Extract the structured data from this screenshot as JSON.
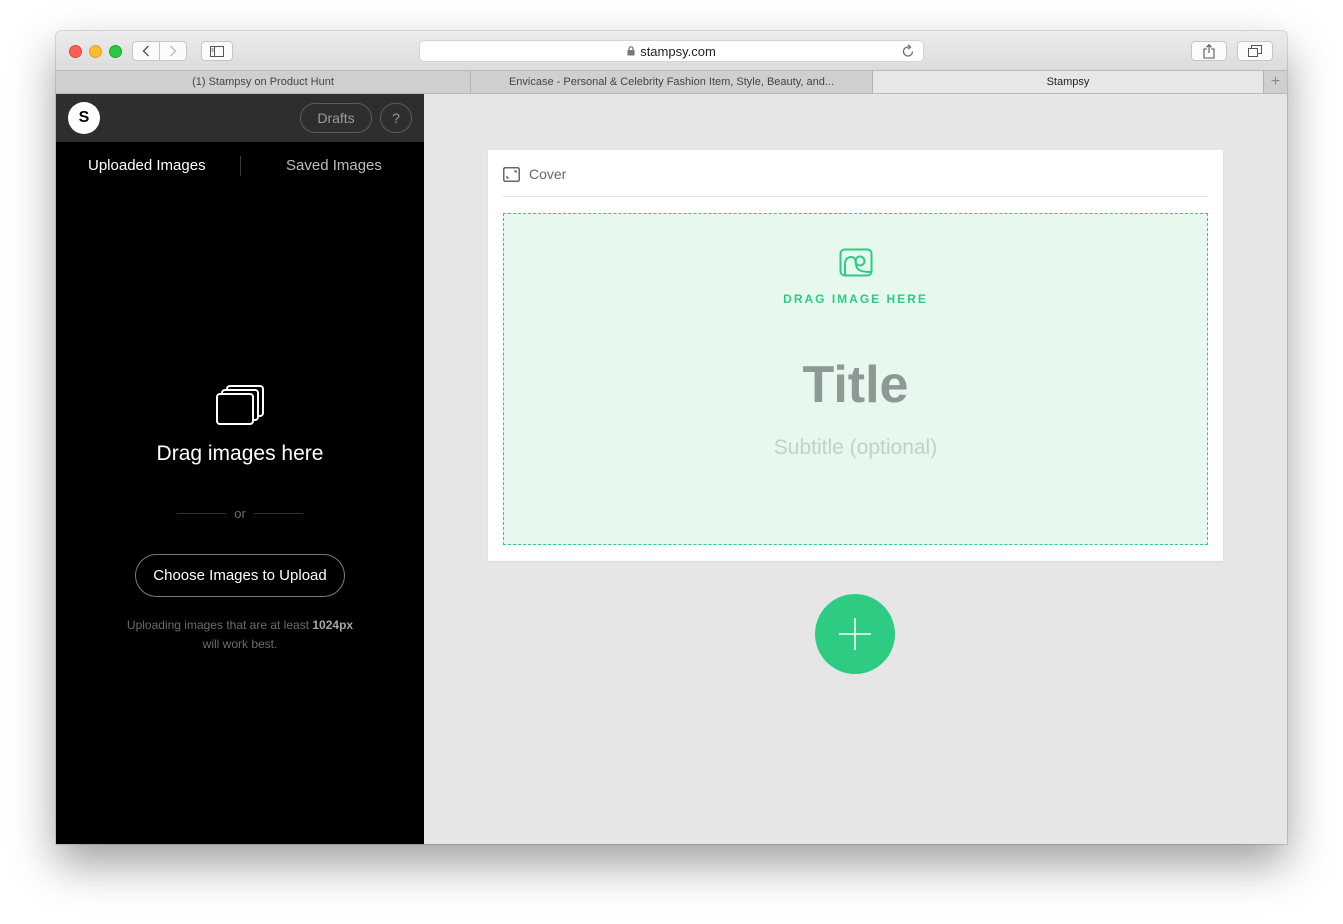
{
  "browser": {
    "url": "stampsy.com",
    "tabs": [
      {
        "label": "(1) Stampsy on Product Hunt"
      },
      {
        "label": "Envicase - Personal & Celebrity Fashion Item, Style, Beauty, and..."
      },
      {
        "label": "Stampsy"
      }
    ],
    "new_tab_label": "+"
  },
  "app": {
    "logo_letter": "S",
    "drafts_label": "Drafts",
    "help_label": "?",
    "tabs": {
      "uploaded": "Uploaded Images",
      "saved": "Saved Images"
    },
    "drop_title": "Drag images here",
    "or_label": "or",
    "choose_button": "Choose Images to Upload",
    "hint": {
      "prefix": "Uploading images that are at least ",
      "size": "1024px",
      "suffix": "will work best."
    }
  },
  "editor": {
    "card_label": "Cover",
    "drag_caption": "DRAG IMAGE HERE",
    "title_placeholder": "Title",
    "subtitle_placeholder": "Subtitle (optional)"
  },
  "colors": {
    "accent": "#2ecb82",
    "dropzone_bg": "#e7f8ef",
    "sidebar_bg": "#000000"
  },
  "icons": {
    "add": "plus-icon",
    "cover": "cover-frame-icon",
    "photo": "photo-icon",
    "stack": "image-stack-icon"
  }
}
